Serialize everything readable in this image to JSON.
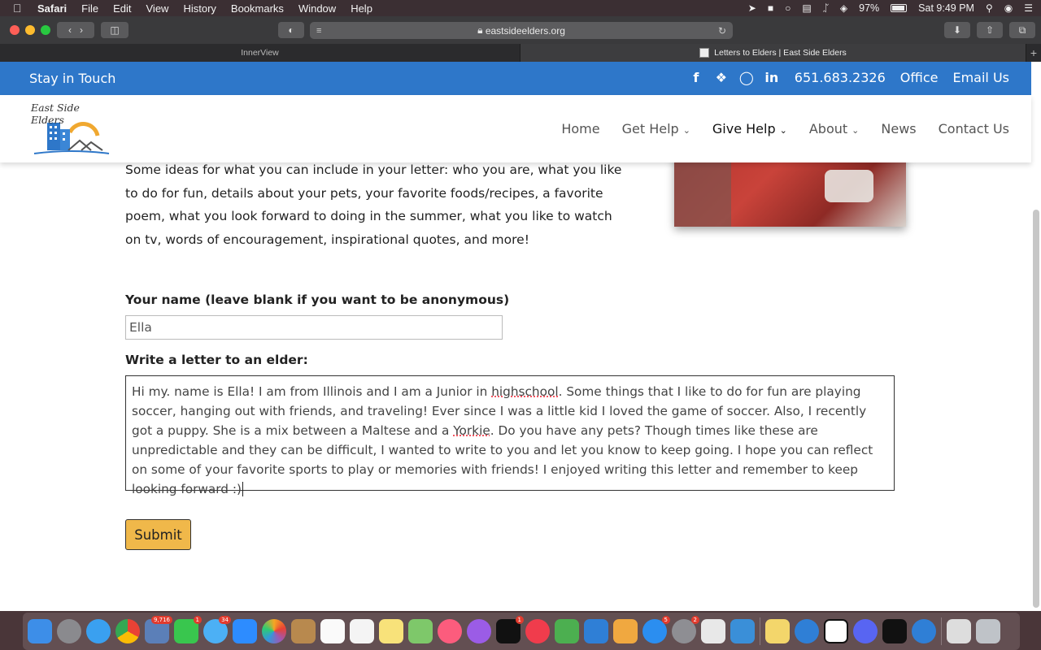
{
  "menubar": {
    "app": "Safari",
    "items": [
      "File",
      "Edit",
      "View",
      "History",
      "Bookmarks",
      "Window",
      "Help"
    ],
    "battery": "97%",
    "clock": "Sat 9:49 PM"
  },
  "browser": {
    "url": "eastsideelders.org",
    "tabs": [
      {
        "title": "InnerView"
      },
      {
        "title": "Letters to Elders | East Side Elders"
      }
    ]
  },
  "site": {
    "topbar": {
      "stay": "Stay in Touch",
      "social": [
        "f",
        "t",
        "ig",
        "in"
      ],
      "phone": "651.683.2326",
      "office": "Office",
      "email": "Email Us"
    },
    "logo_text": "East Side Elders",
    "nav": [
      {
        "label": "Home"
      },
      {
        "label": "Get Help",
        "chevron": "⌄"
      },
      {
        "label": "Give Help",
        "chevron": "⌄"
      },
      {
        "label": "About",
        "chevron": "⌄"
      },
      {
        "label": "News"
      },
      {
        "label": "Contact Us"
      }
    ],
    "brand_color": "#2e77c9",
    "button_color": "#f0b84a"
  },
  "content": {
    "intro": "Some ideas for what you can include in your letter:  who you are, what you like to do for fun, details about your pets, your favorite foods/recipes, a favorite poem, what you look forward to doing in the summer, what you like to watch on tv, words of encouragement, inspirational quotes, and more!"
  },
  "form": {
    "name_label": "Your name (leave blank if you want to be anonymous)",
    "name_value": "Ella",
    "letter_label": "Write a letter to an elder:",
    "letter_part1": "Hi my. name is Ella! I am from Illinois and I am a Junior in ",
    "letter_spell1": "highschool",
    "letter_part2": ". Some things that I like to do for fun are playing soccer, hanging out with friends, and traveling! Ever since I was a little kid I loved the game of soccer. Also, I recently got a puppy. She is a mix between a Maltese and a ",
    "letter_spell2": "Yorkie",
    "letter_part3": ". Do you have any pets? Though times like these are unpredictable and they can be difficult, I wanted to write to you and let you know to keep going. I hope you can reflect on some of your favorite sports to play or memories with friends! I enjoyed writing this letter and remember to keep looking forward :)",
    "submit_label": "Submit"
  },
  "dock": {
    "badges": [
      "9,716",
      "1",
      "34",
      "1",
      "5",
      "2"
    ]
  }
}
